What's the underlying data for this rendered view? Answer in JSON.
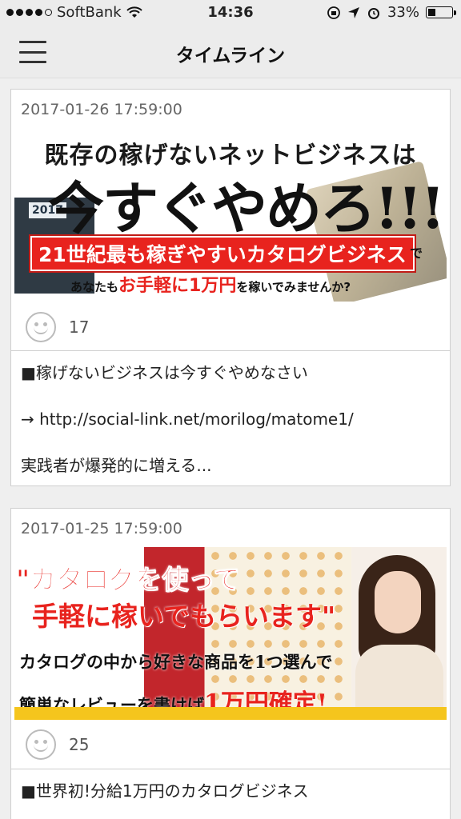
{
  "status_bar": {
    "carrier": "SoftBank",
    "time": "14:36",
    "battery": "33%",
    "battery_level": 0.33,
    "signal_bars": 4
  },
  "nav": {
    "title": "タイムライン"
  },
  "posts": [
    {
      "date": "2017-01-26 17:59:00",
      "banner": {
        "line1": "既存の稼げないネットビジネスは",
        "line2": "今すぐやめろ!!!",
        "book_label": "2017",
        "red_text": "21世紀最も稼ぎやすいカタログビジネス",
        "red_suffix": "で",
        "bottom_prefix": "あなたも",
        "bottom_highlight": "お手軽に1万円",
        "bottom_suffix": "を稼いでみませんか?"
      },
      "likes": "17",
      "text_lines": [
        "■稼げないビジネスは今すぐやめなさい",
        "→ http://social-link.net/morilog/matome1/",
        "実践者が爆発的に増える..."
      ]
    },
    {
      "date": "2017-01-25 17:59:00",
      "banner": {
        "title1": "\"カタログを使って",
        "title2": "手軽に稼いでもらいます\"",
        "sub1": "カタログの中から好きな商品を1つ選んで",
        "sub2_prefix": "簡単なレビューを書けば",
        "sub2_highlight": "1万円確定!"
      },
      "likes": "25",
      "text_lines": [
        "■世界初!分給1万円のカタログビジネス"
      ]
    }
  ]
}
